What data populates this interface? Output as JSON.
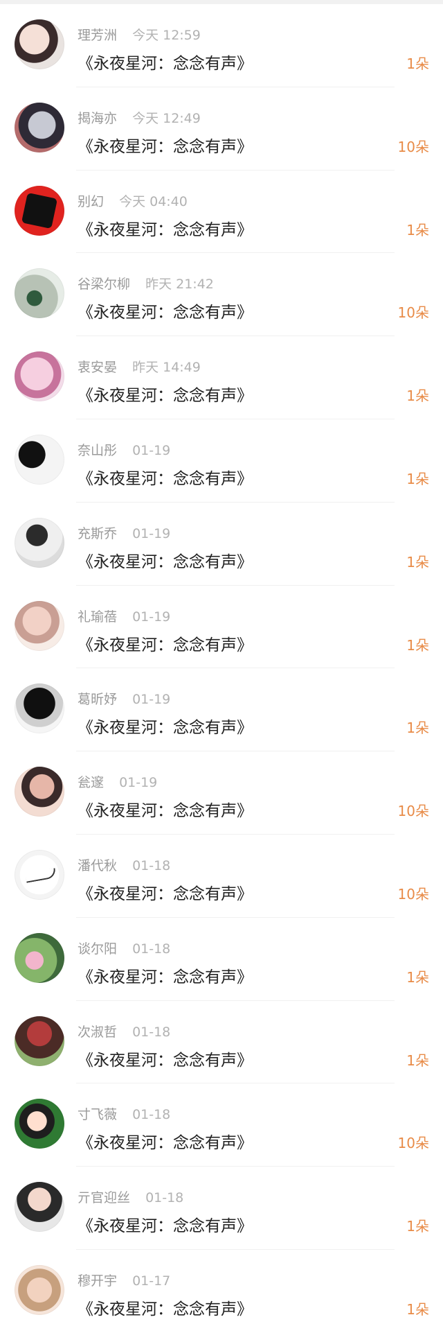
{
  "items": [
    {
      "name": "理芳洲",
      "time": "今天 12:59",
      "message": "《永夜星河：念念有声》",
      "gift": "1朵",
      "avatar_icon": "avatar-icon"
    },
    {
      "name": "揭海亦",
      "time": "今天 12:49",
      "message": "《永夜星河：念念有声》",
      "gift": "10朵",
      "avatar_icon": "avatar-icon"
    },
    {
      "name": "别幻",
      "time": "今天 04:40",
      "message": "《永夜星河：念念有声》",
      "gift": "1朵",
      "avatar_icon": "avatar-icon"
    },
    {
      "name": "谷梁尔柳",
      "time": "昨天 21:42",
      "message": "《永夜星河：念念有声》",
      "gift": "10朵",
      "avatar_icon": "avatar-icon"
    },
    {
      "name": "衷安晏",
      "time": "昨天 14:49",
      "message": "《永夜星河：念念有声》",
      "gift": "1朵",
      "avatar_icon": "avatar-icon"
    },
    {
      "name": "奈山彤",
      "time": "01-19",
      "message": "《永夜星河：念念有声》",
      "gift": "1朵",
      "avatar_icon": "avatar-icon"
    },
    {
      "name": "充斯乔",
      "time": "01-19",
      "message": "《永夜星河：念念有声》",
      "gift": "1朵",
      "avatar_icon": "avatar-icon"
    },
    {
      "name": "礼瑜蓓",
      "time": "01-19",
      "message": "《永夜星河：念念有声》",
      "gift": "1朵",
      "avatar_icon": "avatar-icon"
    },
    {
      "name": "葛昕妤",
      "time": "01-19",
      "message": "《永夜星河：念念有声》",
      "gift": "1朵",
      "avatar_icon": "avatar-icon"
    },
    {
      "name": "瓮邃",
      "time": "01-19",
      "message": "《永夜星河：念念有声》",
      "gift": "10朵",
      "avatar_icon": "avatar-icon"
    },
    {
      "name": "潘代秋",
      "time": "01-18",
      "message": "《永夜星河：念念有声》",
      "gift": "10朵",
      "avatar_icon": "avatar-icon"
    },
    {
      "name": "谈尔阳",
      "time": "01-18",
      "message": "《永夜星河：念念有声》",
      "gift": "1朵",
      "avatar_icon": "avatar-icon"
    },
    {
      "name": "次淑哲",
      "time": "01-18",
      "message": "《永夜星河：念念有声》",
      "gift": "1朵",
      "avatar_icon": "avatar-icon"
    },
    {
      "name": "寸飞薇",
      "time": "01-18",
      "message": "《永夜星河：念念有声》",
      "gift": "10朵",
      "avatar_icon": "avatar-icon"
    },
    {
      "name": "亓官迎丝",
      "time": "01-18",
      "message": "《永夜星河：念念有声》",
      "gift": "1朵",
      "avatar_icon": "avatar-icon"
    },
    {
      "name": "穆开宇",
      "time": "01-17",
      "message": "《永夜星河：念念有声》",
      "gift": "1朵",
      "avatar_icon": "avatar-icon"
    }
  ],
  "colors": {
    "gift": "#e88b47",
    "meta": "#9a9a9a",
    "text": "#222222"
  }
}
